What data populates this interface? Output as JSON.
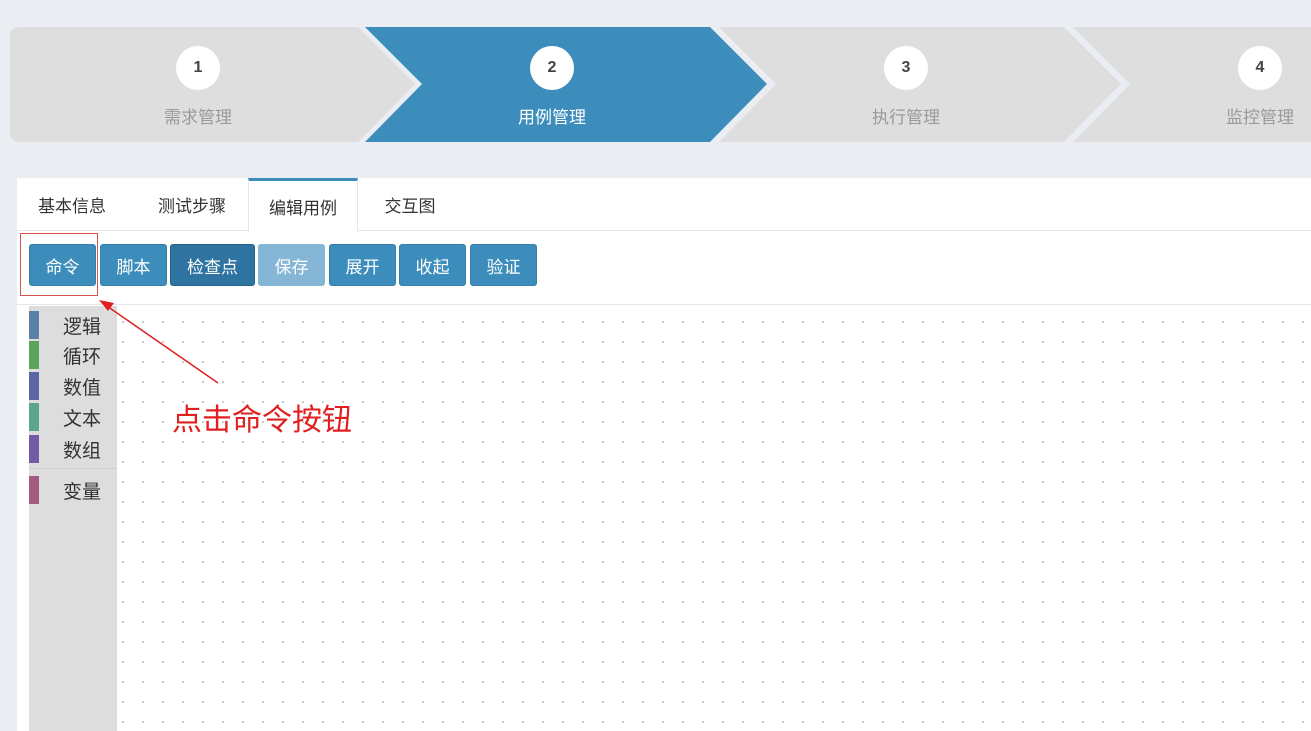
{
  "steps": [
    {
      "number": "1",
      "label": "需求管理",
      "active": false
    },
    {
      "number": "2",
      "label": "用例管理",
      "active": true
    },
    {
      "number": "3",
      "label": "执行管理",
      "active": false
    },
    {
      "number": "4",
      "label": "监控管理",
      "active": false
    }
  ],
  "tabs": [
    "基本信息",
    "测试步骤",
    "编辑用例",
    "交互图"
  ],
  "active_tab": "编辑用例",
  "toolbar": {
    "command": "命令",
    "script": "脚本",
    "checkpoint": "检查点",
    "save": "保存",
    "expand": "展开",
    "collapse": "收起",
    "verify": "验证"
  },
  "categories": [
    {
      "name": "逻辑",
      "color": "#5b80a5"
    },
    {
      "name": "循环",
      "color": "#5ba55b"
    },
    {
      "name": "数值",
      "color": "#5b67a5"
    },
    {
      "name": "文本",
      "color": "#5ba58c"
    },
    {
      "name": "数组",
      "color": "#745ba5"
    },
    {
      "name": "变量",
      "color": "#a55b80"
    }
  ],
  "annotation": {
    "text": "点击命令按钮",
    "color": "#e02020"
  },
  "colors": {
    "accent": "#3c8dbc",
    "step_inactive": "#dedede"
  }
}
